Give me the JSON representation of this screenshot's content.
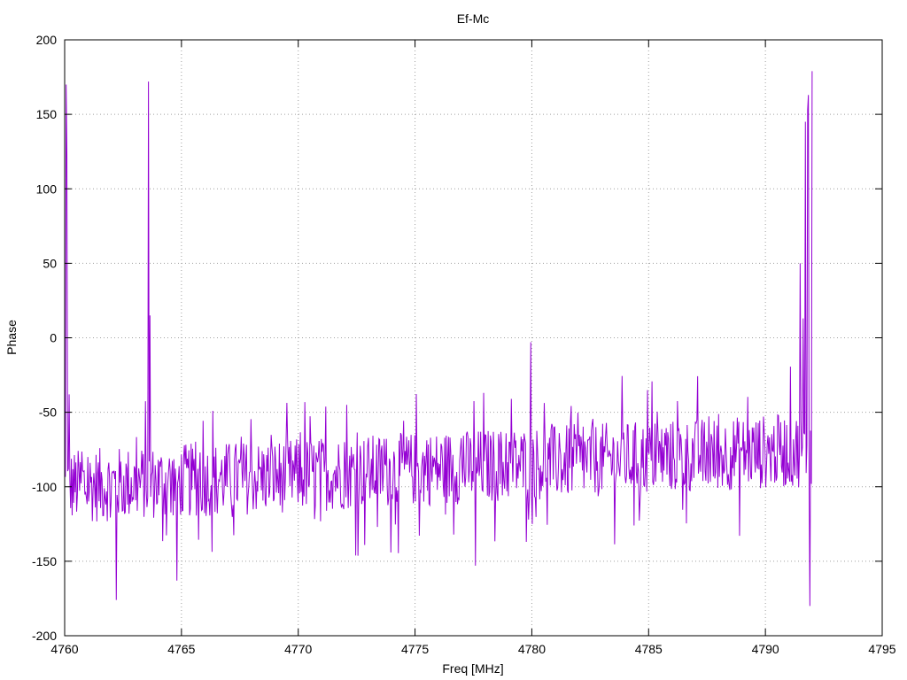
{
  "chart_data": {
    "type": "line",
    "title": "Ef-Mc",
    "xlabel": "Freq [MHz]",
    "ylabel": "Phase",
    "xlim": [
      4760,
      4795
    ],
    "ylim": [
      -200,
      200
    ],
    "xticks": [
      "4760",
      "4765",
      "4770",
      "4775",
      "4780",
      "4785",
      "4790",
      "4795"
    ],
    "yticks": [
      "-200",
      "-150",
      "-100",
      "-50",
      "0",
      "50",
      "100",
      "150",
      "200"
    ],
    "grid": true,
    "legend": "none",
    "series": [
      {
        "color": "#9400d3",
        "x_start": 4760.0,
        "x_end": 4792.0,
        "points": 1000,
        "baseline_start": -100,
        "baseline_end": -75,
        "noise_amplitude": 25,
        "spikes": [
          {
            "x": 4760.05,
            "y": 170
          },
          {
            "x": 4760.1,
            "y": 123
          },
          {
            "x": 4760.2,
            "y": -38
          },
          {
            "x": 4763.6,
            "y": 172
          },
          {
            "x": 4763.65,
            "y": 15
          },
          {
            "x": 4762.2,
            "y": -176
          },
          {
            "x": 4764.8,
            "y": -163
          },
          {
            "x": 4779.95,
            "y": -3
          },
          {
            "x": 4777.6,
            "y": -153
          },
          {
            "x": 4791.5,
            "y": 50
          },
          {
            "x": 4791.6,
            "y": 13
          },
          {
            "x": 4791.7,
            "y": 145
          },
          {
            "x": 4791.8,
            "y": 153
          },
          {
            "x": 4791.85,
            "y": 163
          },
          {
            "x": 4791.9,
            "y": -180
          },
          {
            "x": 4792.0,
            "y": 179
          }
        ]
      }
    ]
  }
}
